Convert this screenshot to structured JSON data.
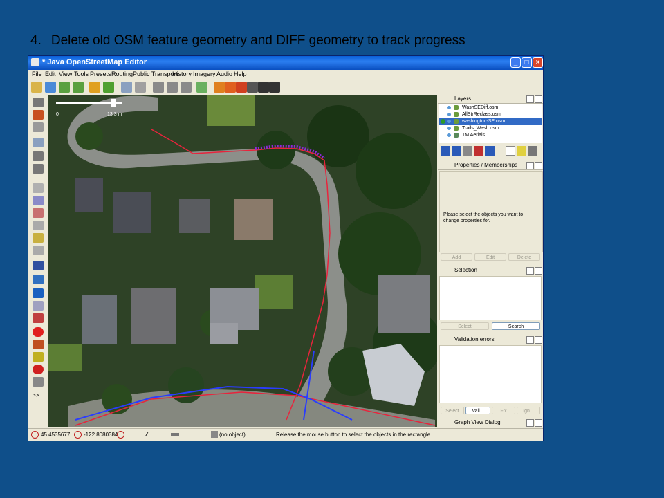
{
  "slide": {
    "number": "4.",
    "heading": "Delete old OSM feature geometry and DIFF geometry to track progress"
  },
  "window": {
    "title": "* Java OpenStreetMap Editor",
    "buttons": [
      "_",
      "□",
      "×"
    ]
  },
  "menu": [
    "File",
    "Edit",
    "View",
    "Tools",
    "Presets",
    "Routing",
    "Public Transport",
    "History",
    "Imagery",
    "Audio",
    "Help"
  ],
  "map": {
    "scale_start": "0",
    "scale_end": "13.3 m"
  },
  "layers": {
    "title": "Layers",
    "items": [
      {
        "name": "WashSEDiff.osm",
        "selected": false,
        "active": false
      },
      {
        "name": "AllStrReclass.osm",
        "selected": false,
        "active": false
      },
      {
        "name": "washington-SE.osm",
        "selected": true,
        "active": true
      },
      {
        "name": "Trails_Wash.osm",
        "selected": false,
        "active": false
      },
      {
        "name": "TM Aerials",
        "selected": false,
        "active": false
      }
    ]
  },
  "properties": {
    "title": "Properties / Memberships",
    "message": "Please select the objects you want to change properties for.",
    "buttons": [
      "Add",
      "Edit",
      "Delete"
    ]
  },
  "selection": {
    "title": "Selection",
    "buttons": [
      "Select",
      "Search"
    ]
  },
  "validation": {
    "title": "Validation errors",
    "buttons": [
      "Select",
      "Vali...",
      "Fix",
      "Ign..."
    ]
  },
  "graph": {
    "title": "Graph View Dialog"
  },
  "status": {
    "lat": "45.4535677",
    "lon": "-122.8080384",
    "object": "(no object)",
    "message": "Release the mouse button to select the objects in the rectangle."
  },
  "colors": {
    "background": "#0f4f8a",
    "titlebar": "#0a5fd8",
    "selected_layer": "#316ac5",
    "way_red": "#e8243c",
    "way_blue": "#2a3cff"
  },
  "icons": [
    "select-icon",
    "draw-icon",
    "zoom-icon",
    "delete-icon",
    "undo-icon",
    "redo-icon",
    "open-icon",
    "save-icon",
    "upload-icon",
    "preferences-icon"
  ]
}
